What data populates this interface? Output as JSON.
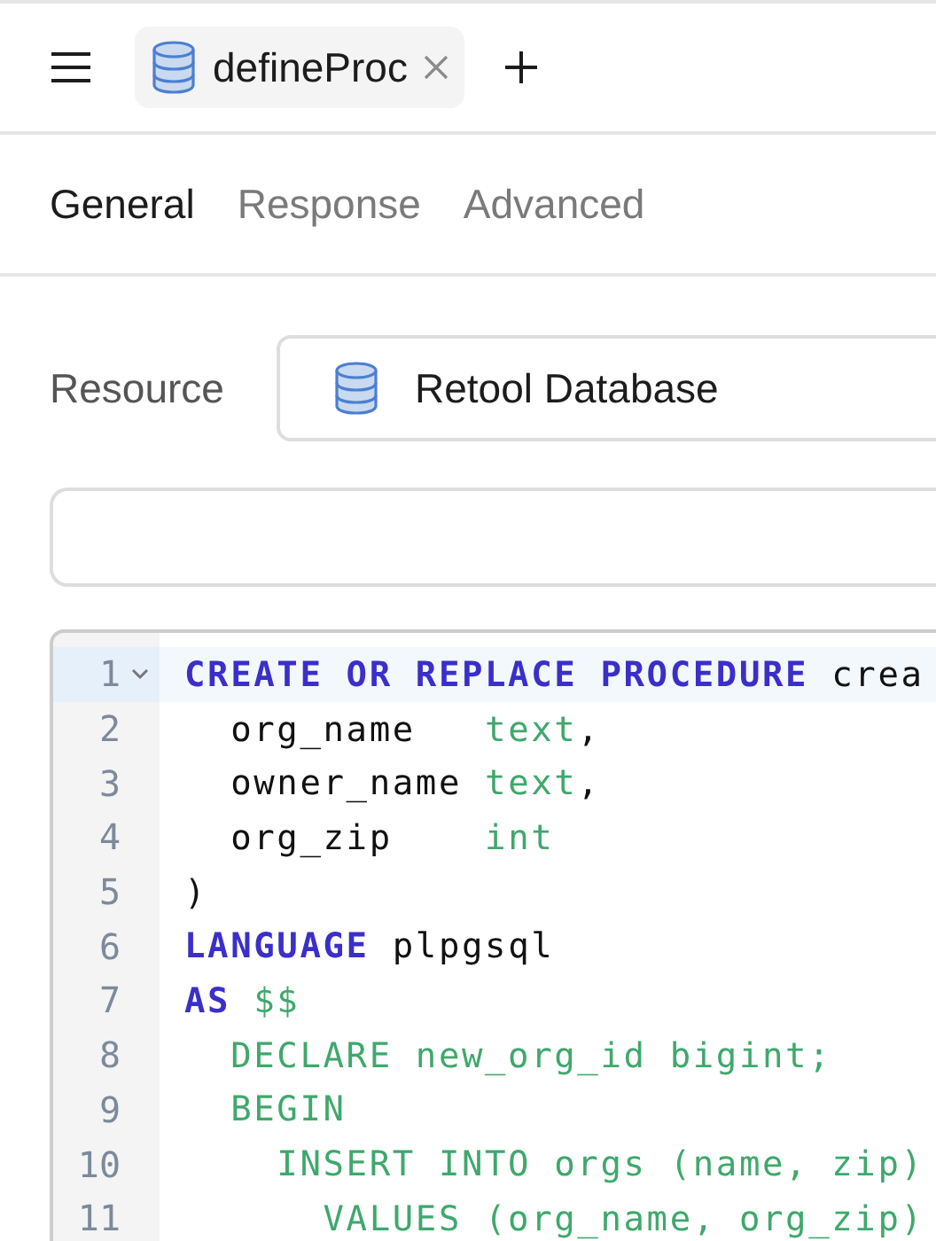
{
  "header": {
    "tab": {
      "title": "defineProc"
    }
  },
  "tabs": [
    {
      "label": "General",
      "selected": true
    },
    {
      "label": "Response",
      "selected": false
    },
    {
      "label": "Advanced",
      "selected": false
    }
  ],
  "resource": {
    "label": "Resource",
    "value": "Retool Database"
  },
  "editor": {
    "lines": [
      {
        "number": "1",
        "active": true,
        "foldable": true,
        "tokens": [
          {
            "kind": "kw",
            "text": "CREATE OR REPLACE PROCEDURE"
          },
          {
            "kind": "plain",
            "text": " crea"
          }
        ]
      },
      {
        "number": "2",
        "active": false,
        "foldable": false,
        "tokens": [
          {
            "kind": "plain",
            "text": "  org_name   "
          },
          {
            "kind": "type",
            "text": "text"
          },
          {
            "kind": "plain",
            "text": ","
          }
        ]
      },
      {
        "number": "3",
        "active": false,
        "foldable": false,
        "tokens": [
          {
            "kind": "plain",
            "text": "  owner_name "
          },
          {
            "kind": "type",
            "text": "text"
          },
          {
            "kind": "plain",
            "text": ","
          }
        ]
      },
      {
        "number": "4",
        "active": false,
        "foldable": false,
        "tokens": [
          {
            "kind": "plain",
            "text": "  org_zip    "
          },
          {
            "kind": "type",
            "text": "int"
          }
        ]
      },
      {
        "number": "5",
        "active": false,
        "foldable": false,
        "tokens": [
          {
            "kind": "plain",
            "text": ")"
          }
        ]
      },
      {
        "number": "6",
        "active": false,
        "foldable": false,
        "tokens": [
          {
            "kind": "kw",
            "text": "LANGUAGE"
          },
          {
            "kind": "plain",
            "text": " plpgsql"
          }
        ]
      },
      {
        "number": "7",
        "active": false,
        "foldable": false,
        "tokens": [
          {
            "kind": "kw",
            "text": "AS"
          },
          {
            "kind": "type",
            "text": " $$"
          }
        ]
      },
      {
        "number": "8",
        "active": false,
        "foldable": false,
        "tokens": [
          {
            "kind": "type",
            "text": "  DECLARE new_org_id bigint;"
          }
        ]
      },
      {
        "number": "9",
        "active": false,
        "foldable": false,
        "tokens": [
          {
            "kind": "type",
            "text": "  BEGIN"
          }
        ]
      },
      {
        "number": "10",
        "active": false,
        "foldable": false,
        "tokens": [
          {
            "kind": "type",
            "text": "    INSERT INTO orgs (name, zip)"
          }
        ]
      },
      {
        "number": "11",
        "active": false,
        "foldable": false,
        "tokens": [
          {
            "kind": "type",
            "text": "      VALUES (org_name, org_zip)"
          }
        ]
      }
    ]
  }
}
